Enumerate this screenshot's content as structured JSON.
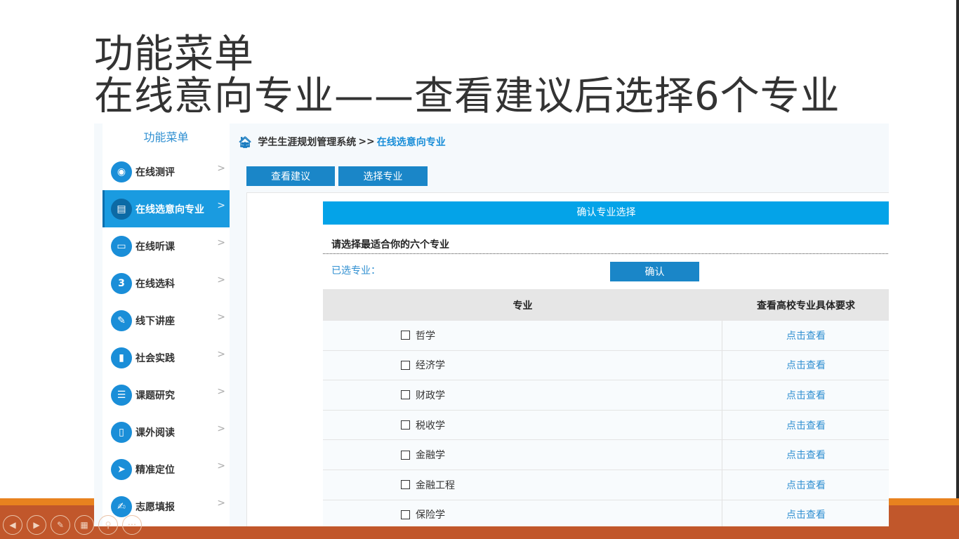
{
  "slide_title": {
    "line1": "功能菜单",
    "line2": "在线意向专业——查看建议后选择6个专业"
  },
  "sidebar": {
    "title": "功能菜单",
    "items": [
      {
        "label": "在线测评",
        "icon": "rss-icon",
        "glyph": "◉",
        "active": false
      },
      {
        "label": "在线选意向专业",
        "icon": "document-icon",
        "glyph": "▤",
        "active": true
      },
      {
        "label": "在线听课",
        "icon": "monitor-icon",
        "glyph": "▭",
        "active": false
      },
      {
        "label": "在线选科",
        "icon": "number-three-icon",
        "glyph": "3",
        "active": false
      },
      {
        "label": "线下讲座",
        "icon": "microphone-icon",
        "glyph": "✎",
        "active": false
      },
      {
        "label": "社会实践",
        "icon": "bookmark-icon",
        "glyph": "▮",
        "active": false
      },
      {
        "label": "课题研究",
        "icon": "list-icon",
        "glyph": "☰",
        "active": false
      },
      {
        "label": "课外阅读",
        "icon": "book-icon",
        "glyph": "▯",
        "active": false
      },
      {
        "label": "精准定位",
        "icon": "send-icon",
        "glyph": "➤",
        "active": false
      },
      {
        "label": "志愿填报",
        "icon": "edit-form-icon",
        "glyph": "✍",
        "active": false
      }
    ],
    "arrow": ">"
  },
  "breadcrumb": {
    "home_icon": "home-icon",
    "system": "学生生涯规划管理系统",
    "separator": ">>",
    "current": "在线选意向专业"
  },
  "tabs": {
    "view_suggestion": "查看建议",
    "select_major": "选择专业"
  },
  "panel": {
    "header": "确认专业选择",
    "instruction": "请选择最适合你的六个专业",
    "selected_label": "已选专业：",
    "confirm_button": "确认"
  },
  "table": {
    "headers": [
      "专业",
      "查看高校专业具体要求"
    ],
    "rows": [
      {
        "major": "哲学",
        "link": "点击查看",
        "checked": false
      },
      {
        "major": "经济学",
        "link": "点击查看",
        "checked": false
      },
      {
        "major": "财政学",
        "link": "点击查看",
        "checked": false
      },
      {
        "major": "税收学",
        "link": "点击查看",
        "checked": false
      },
      {
        "major": "金融学",
        "link": "点击查看",
        "checked": false
      },
      {
        "major": "金融工程",
        "link": "点击查看",
        "checked": false
      },
      {
        "major": "保险学",
        "link": "点击查看",
        "checked": false
      }
    ]
  },
  "colors": {
    "accent_blue": "#1a86c8",
    "header_blue": "#04a3e8",
    "link_blue": "#2f8fd1",
    "orange_band": "#e8821f",
    "bottom_band": "#c1572b"
  },
  "player_controls": [
    {
      "name": "previous-icon",
      "glyph": "◀"
    },
    {
      "name": "next-icon",
      "glyph": "▶"
    },
    {
      "name": "pen-icon",
      "glyph": "✎"
    },
    {
      "name": "slides-icon",
      "glyph": "▦"
    },
    {
      "name": "zoom-icon",
      "glyph": "⚲"
    },
    {
      "name": "more-icon",
      "glyph": "•••"
    }
  ]
}
